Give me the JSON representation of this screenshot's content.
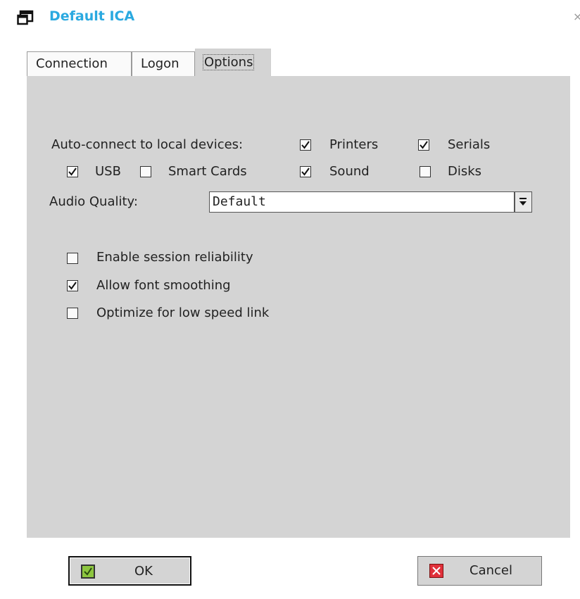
{
  "window": {
    "title": "Default ICA",
    "close_glyph": "×"
  },
  "tabs": [
    {
      "label": "Connection",
      "active": false
    },
    {
      "label": "Logon",
      "active": false
    },
    {
      "label": "Options",
      "active": true
    }
  ],
  "options": {
    "autoconnect_label": "Auto-connect to local devices:",
    "devices": [
      {
        "label": "Printers",
        "checked": true
      },
      {
        "label": "Serials",
        "checked": true
      },
      {
        "label": "USB",
        "checked": true
      },
      {
        "label": "Smart Cards",
        "checked": false
      },
      {
        "label": "Sound",
        "checked": true
      },
      {
        "label": "Disks",
        "checked": false
      }
    ],
    "audio_label": "Audio Quality:",
    "audio_value": "Default",
    "flags": [
      {
        "label": "Enable session reliability",
        "checked": false
      },
      {
        "label": "Allow font smoothing",
        "checked": true
      },
      {
        "label": "Optimize for low speed link",
        "checked": false
      }
    ]
  },
  "buttons": {
    "ok": "OK",
    "cancel": "Cancel"
  },
  "colors": {
    "title": "#2aa9e0",
    "panel": "#d4d4d4",
    "ok_icon": "#8dc63f",
    "cancel_icon": "#e0303a"
  },
  "icons": {
    "window": "window-icon",
    "ok": "checkmark-icon",
    "cancel": "x-mark-icon",
    "dropdown": "chevron-down-icon"
  }
}
